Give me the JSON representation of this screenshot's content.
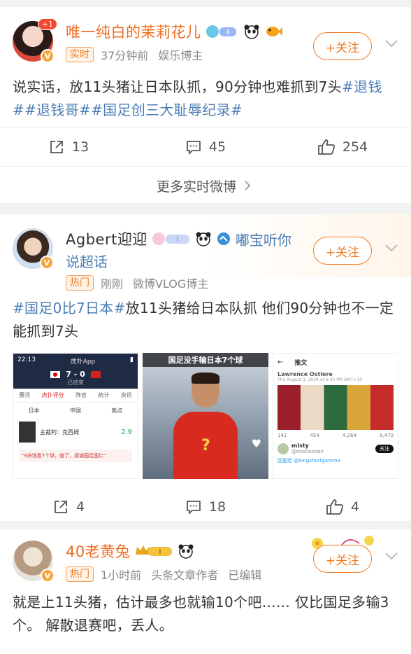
{
  "post1": {
    "username": "唯一纯白的茉莉花儿",
    "avatar_badge": "+1",
    "tag": "实时",
    "time": "37分钟前",
    "role": "娱乐博主",
    "follow_label": "+关注",
    "text_plain": "说实话，放11头猪让日本队抓，90分钟也难抓到7头",
    "hashtags": [
      "#退钱#",
      "#退钱哥#",
      "#国足创三大耻辱纪录#"
    ],
    "shares": "13",
    "comments": "45",
    "likes": "254"
  },
  "more_label": "更多实时微博",
  "post2": {
    "username": "Agbert迎迎",
    "extra_line1": "嘟宝听你",
    "extra_line2": "说超话",
    "tag": "热门",
    "time": "刚刚",
    "role": "微博VLOG博主",
    "follow_label": "+关注",
    "hashtag": "#国足0比7日本#",
    "text_plain": "放11头猪给日本队抓 他们90分钟也不一定能抓到7头",
    "img1": {
      "time": "22:13",
      "app": "虎扑App",
      "score": "7 - 0",
      "status": "已结束",
      "tabs": [
        "赛况",
        "虎扑评分",
        "阵容",
        "统计",
        "资讯"
      ],
      "team1": "日本",
      "team2": "中国",
      "focus": "焦点",
      "player": "主裁判：克西姆",
      "rating": "2.9",
      "comment": "\"9块钱看7个球，值了，感谢国足国片\""
    },
    "img2": {
      "caption": "国足没手输日本7个球",
      "shirt_mark": "?"
    },
    "img3": {
      "title": "推文",
      "author": "Lawrence Ostlere",
      "date": "Thu August 1, 2024 at 6:42 PM GMT+10",
      "stats": [
        "141",
        "454",
        "4,264",
        "9,470"
      ],
      "user": "misty",
      "handle": "@mistlondon",
      "follow": "关注",
      "reply": "回复给 @longshortgamma"
    },
    "shares": "4",
    "comments": "18",
    "likes": "4"
  },
  "post3": {
    "username": "40老黄兔",
    "tag": "热门",
    "time": "1小时前",
    "role": "头条文章作者",
    "edited": "已编辑",
    "follow_label": "+关注",
    "text": "就是上11头猪，估计最多也就输10个吧…… 仅比国足多输3个。 解散退赛吧，丢人。"
  },
  "colors": {
    "accent": "#f17a24",
    "hashtag": "#4a7db7",
    "username": "#f16c1f"
  },
  "icons": [
    "share-icon",
    "comment-icon",
    "like-icon",
    "chevron-down-icon",
    "chevron-right-icon",
    "verified-icon"
  ]
}
